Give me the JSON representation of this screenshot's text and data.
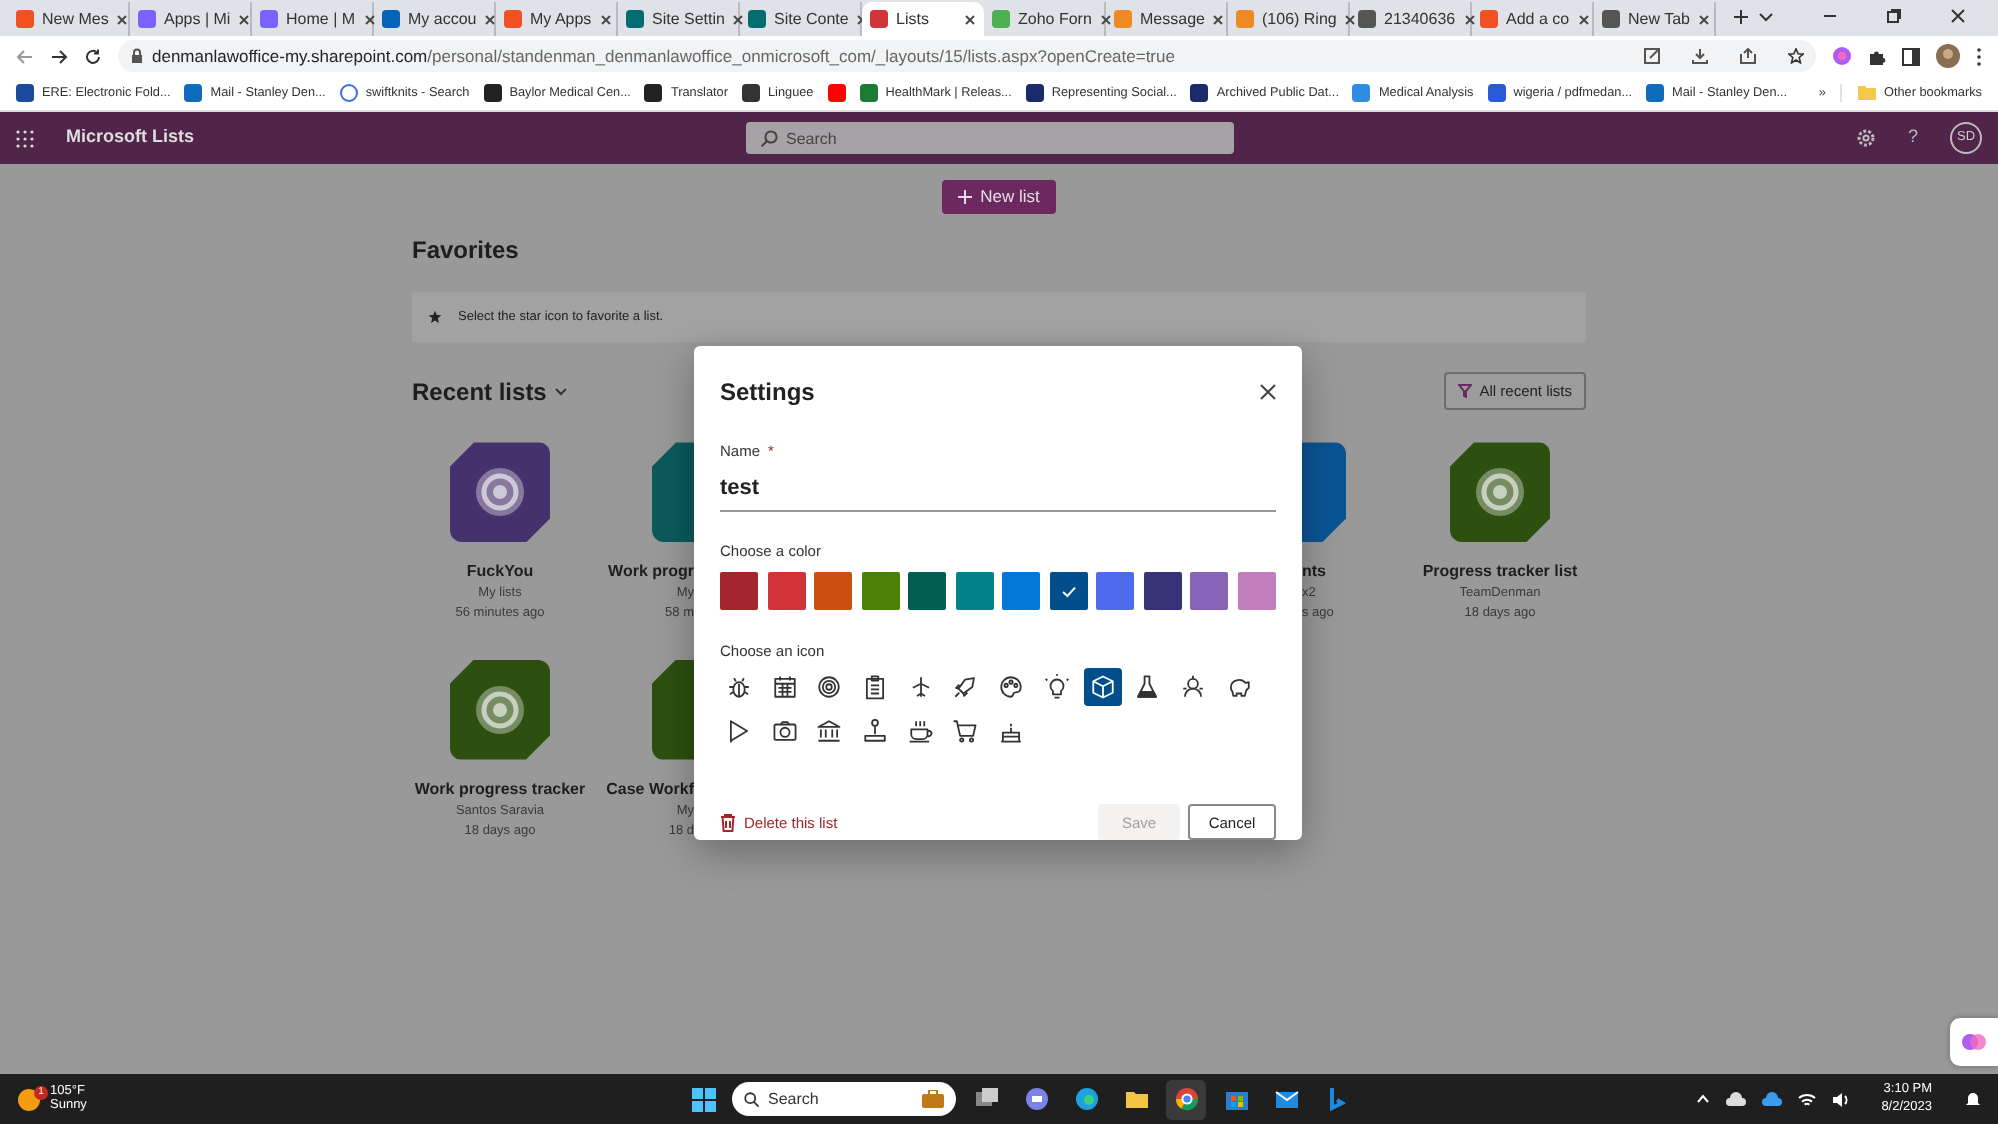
{
  "browser": {
    "tabs": [
      {
        "label": "New Mes",
        "selected": false
      },
      {
        "label": "Apps | Mi",
        "selected": false
      },
      {
        "label": "Home | M",
        "selected": false
      },
      {
        "label": "My accou",
        "selected": false
      },
      {
        "label": "My Apps",
        "selected": false
      },
      {
        "label": "Site Settin",
        "selected": false
      },
      {
        "label": "Site Conte",
        "selected": false
      },
      {
        "label": "Lists",
        "selected": true
      },
      {
        "label": "Zoho Forn",
        "selected": false
      },
      {
        "label": "Message",
        "selected": false
      },
      {
        "label": "(106) Ring",
        "selected": false
      },
      {
        "label": "21340636",
        "selected": false
      },
      {
        "label": "Add a co",
        "selected": false
      },
      {
        "label": "New Tab",
        "selected": false
      }
    ],
    "url": {
      "host": "denmanlawoffice-my.sharepoint.com",
      "path": "/personal/standenman_denmanlawoffice_onmicrosoft_com/_layouts/15/lists.aspx?openCreate=true"
    },
    "bookmarks": [
      {
        "kind": "link",
        "label": "ERE: Electronic Fold..."
      },
      {
        "kind": "link",
        "label": "Mail - Stanley Den..."
      },
      {
        "kind": "link",
        "label": "swiftknits - Search"
      },
      {
        "kind": "link",
        "label": "Baylor Medical Cen..."
      },
      {
        "kind": "link",
        "label": "Translator"
      },
      {
        "kind": "link",
        "label": "Linguee"
      },
      {
        "kind": "icon"
      },
      {
        "kind": "link",
        "label": "HealthMark | Releas..."
      },
      {
        "kind": "link",
        "label": "Representing Social..."
      },
      {
        "kind": "link",
        "label": "Archived Public Dat..."
      },
      {
        "kind": "link",
        "label": "Medical Analysis"
      },
      {
        "kind": "link",
        "label": "wigeria / pdfmedan..."
      },
      {
        "kind": "link",
        "label": "Mail - Stanley Den..."
      }
    ],
    "more_bookmarks": "»",
    "other_bookmarks": "Other bookmarks"
  },
  "app_bar": {
    "title": "Microsoft Lists",
    "search": {
      "placeholder": "Search"
    },
    "help": "?",
    "avatar": "SD"
  },
  "new_list_button": "New list",
  "favorites": {
    "title": "Favorites",
    "hint": "Select the star icon to favorite a list."
  },
  "recent": {
    "title": "Recent lists",
    "filter_button": "All recent lists",
    "rows": [
      [
        {
          "kind": "full",
          "name": "FuckYou",
          "owner": "My lists",
          "time": "56 minutes ago",
          "color": "#45316b"
        },
        {
          "kind": "cut_right",
          "name": "Work progr",
          "owner": "My",
          "time": "58 m",
          "color": "#0b5a5c"
        },
        {
          "kind": "cut_left",
          "name": "nts",
          "owner": "x2",
          "time": "s ago",
          "color": "#0a5494"
        },
        {
          "kind": "full",
          "name": "Progress tracker list",
          "owner": "TeamDenman",
          "time": "18 days ago",
          "color": "#2d5010"
        }
      ],
      [
        {
          "kind": "full",
          "name": "Work progress tracker",
          "owner": "Santos Saravia",
          "time": "18 days ago",
          "color": "#2d5010"
        },
        {
          "kind": "cut_right",
          "name": "Case Workf",
          "owner": "My",
          "time": "18 d",
          "color": "#2d5010"
        }
      ]
    ]
  },
  "dialog": {
    "title": "Settings",
    "name_label": "Name",
    "required_mark": "*",
    "name_value": "test",
    "color_label": "Choose a color",
    "colors": [
      {
        "color": "#a4262c",
        "selected": false
      },
      {
        "color": "#d13438",
        "selected": false
      },
      {
        "color": "#ca5010",
        "selected": false
      },
      {
        "color": "#498205",
        "selected": false
      },
      {
        "color": "#005e50",
        "selected": false
      },
      {
        "color": "#038387",
        "selected": false
      },
      {
        "color": "#0078d4",
        "selected": false
      },
      {
        "color": "#004e8c",
        "selected": true
      },
      {
        "color": "#4f6bed",
        "selected": false
      },
      {
        "color": "#373277",
        "selected": false
      },
      {
        "color": "#8764b8",
        "selected": false
      },
      {
        "color": "#c27ebd",
        "selected": false
      }
    ],
    "icon_label": "Choose an icon",
    "icons": [
      {
        "selected": false
      },
      {
        "selected": false
      },
      {
        "selected": false
      },
      {
        "selected": false
      },
      {
        "selected": false
      },
      {
        "selected": false
      },
      {
        "selected": false
      },
      {
        "selected": false
      },
      {
        "selected": true
      },
      {
        "selected": false
      },
      {
        "selected": false
      },
      {
        "selected": false
      },
      {
        "selected": false
      },
      {
        "selected": false
      },
      {
        "selected": false
      },
      {
        "selected": false
      },
      {
        "selected": false
      },
      {
        "selected": false
      },
      {
        "selected": false
      }
    ],
    "delete": "Delete this list",
    "save": {
      "label": "Save",
      "disabled": true
    },
    "cancel": "Cancel"
  },
  "taskbar": {
    "weather": {
      "badge": "1",
      "temp": "105°F",
      "condition": "Sunny"
    },
    "search": {
      "placeholder": "Search"
    },
    "apps": [
      {
        "selected": false
      },
      {
        "selected": false
      },
      {
        "selected": false
      },
      {
        "selected": false
      },
      {
        "selected": true
      },
      {
        "selected": false
      },
      {
        "selected": false
      },
      {
        "selected": false
      }
    ],
    "time": "3:10 PM",
    "date": "8/2/2023"
  }
}
